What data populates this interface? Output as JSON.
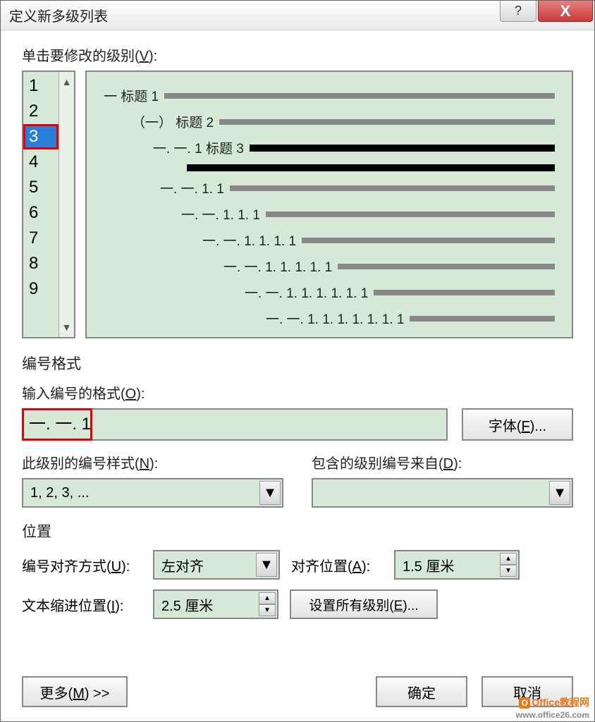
{
  "titlebar": {
    "title": "定义新多级列表",
    "help": "?",
    "close": "X"
  },
  "levels": {
    "label_pre": "单击要修改的级别(",
    "label_key": "V",
    "label_post": "):",
    "items": [
      "1",
      "2",
      "3",
      "4",
      "5",
      "6",
      "7",
      "8",
      "9"
    ],
    "selected": "3"
  },
  "preview": {
    "rows": [
      {
        "indent": 0,
        "text": "一 标题 1",
        "bold": false
      },
      {
        "indent": 40,
        "text": "（一） 标题 2",
        "bold": false
      },
      {
        "indent": 70,
        "text": "一. 一. 1 标题 3",
        "bold": true
      },
      {
        "indent": 110,
        "text": "",
        "bold": true
      },
      {
        "indent": 80,
        "text": "一. 一. 1. 1",
        "bold": false
      },
      {
        "indent": 110,
        "text": "一. 一. 1. 1. 1",
        "bold": false
      },
      {
        "indent": 140,
        "text": "一. 一. 1. 1. 1. 1",
        "bold": false
      },
      {
        "indent": 170,
        "text": "一. 一. 1. 1. 1. 1. 1",
        "bold": false
      },
      {
        "indent": 200,
        "text": "一. 一. 1. 1. 1. 1. 1. 1",
        "bold": false
      },
      {
        "indent": 230,
        "text": "一. 一. 1. 1. 1. 1. 1. 1. 1",
        "bold": false
      }
    ]
  },
  "format": {
    "section": "编号格式",
    "input_label_pre": "输入编号的格式(",
    "input_label_key": "O",
    "input_label_post": "):",
    "input_value": "一. 一. 1",
    "font_btn_pre": "字体(",
    "font_btn_key": "F",
    "font_btn_post": ")...",
    "style_label_pre": "此级别的编号样式(",
    "style_label_key": "N",
    "style_label_post": "):",
    "style_value": "1, 2, 3, ...",
    "include_label_pre": "包含的级别编号来自(",
    "include_label_key": "D",
    "include_label_post": "):",
    "include_value": ""
  },
  "position": {
    "section": "位置",
    "align_label_pre": "编号对齐方式(",
    "align_label_key": "U",
    "align_label_post": "):",
    "align_value": "左对齐",
    "alignpos_label_pre": "对齐位置(",
    "alignpos_label_key": "A",
    "alignpos_label_post": "):",
    "alignpos_value": "1.5 厘米",
    "indent_label_pre": "文本缩进位置(",
    "indent_label_key": "I",
    "indent_label_post": "):",
    "indent_value": "2.5 厘米",
    "setall_pre": "设置所有级别(",
    "setall_key": "E",
    "setall_post": ")..."
  },
  "footer": {
    "more_pre": "更多(",
    "more_key": "M",
    "more_post": ") >>",
    "ok": "确定",
    "cancel": "取消"
  },
  "watermark": {
    "line1": "Office教程网",
    "line2": "www.office26.com"
  }
}
